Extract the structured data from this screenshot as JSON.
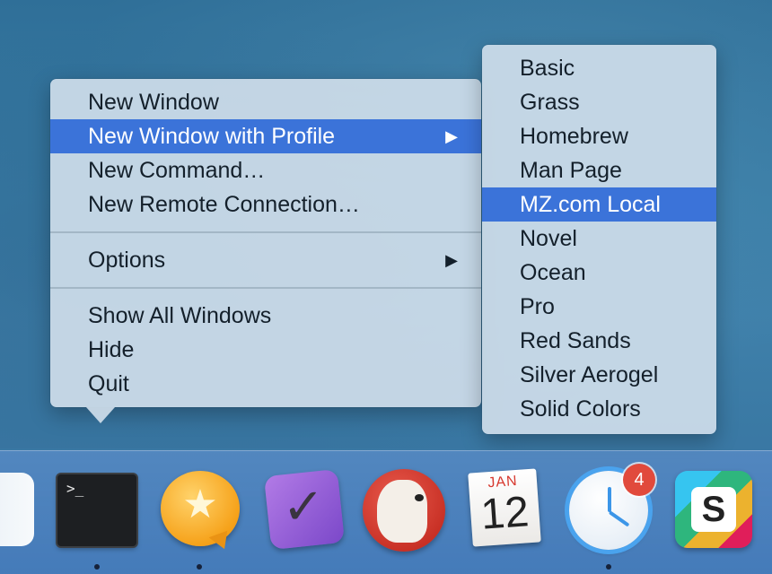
{
  "main_menu": {
    "items": [
      {
        "label": "New Window"
      },
      {
        "label": "New Window with Profile",
        "submenu_arrow": "▶"
      },
      {
        "label": "New Command…"
      },
      {
        "label": "New Remote Connection…"
      },
      {
        "label": "Options",
        "submenu_arrow": "▶"
      },
      {
        "label": "Show All Windows"
      },
      {
        "label": "Hide"
      },
      {
        "label": "Quit"
      }
    ]
  },
  "profile_submenu": {
    "items": [
      {
        "label": "Basic"
      },
      {
        "label": "Grass"
      },
      {
        "label": "Homebrew"
      },
      {
        "label": "Man Page"
      },
      {
        "label": "MZ.com Local"
      },
      {
        "label": "Novel"
      },
      {
        "label": "Ocean"
      },
      {
        "label": "Pro"
      },
      {
        "label": "Red Sands"
      },
      {
        "label": "Silver Aerogel"
      },
      {
        "label": "Solid Colors"
      }
    ]
  },
  "dock": {
    "terminal": {
      "prompt": ">_"
    },
    "reeder": {
      "glyph": "★"
    },
    "omnifocus": {
      "glyph": "✓"
    },
    "calendar": {
      "month": "JAN",
      "day": "12"
    },
    "airmail": {
      "badge": "4"
    },
    "slack": {
      "glyph": "S"
    }
  },
  "colors": {
    "highlight": "#3b73d9",
    "menu_background": "#cdddea",
    "badge": "#e14a3c"
  }
}
